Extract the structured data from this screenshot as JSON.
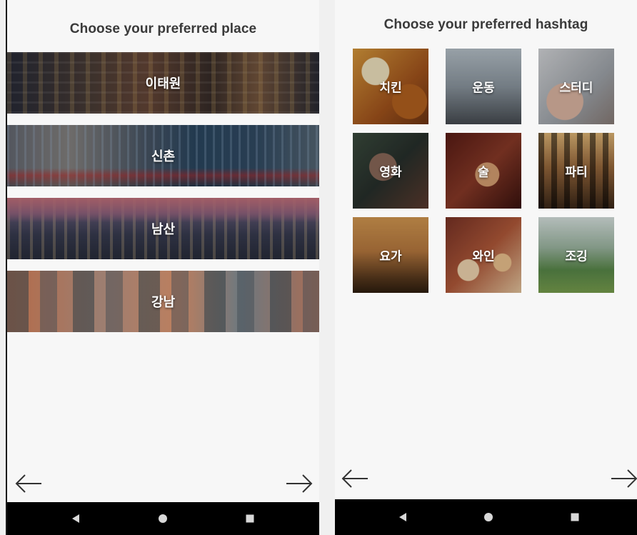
{
  "place_screen": {
    "title": "Choose your preferred place",
    "places": [
      {
        "label": "이태원",
        "icon": "itaewon-photo"
      },
      {
        "label": "신촌",
        "icon": "sinchon-photo"
      },
      {
        "label": "남산",
        "icon": "namsan-photo"
      },
      {
        "label": "강남",
        "icon": "gangnam-photo"
      }
    ]
  },
  "hashtag_screen": {
    "title": "Choose your preferred hashtag",
    "tags": [
      {
        "label": "치킨",
        "icon": "chicken-photo"
      },
      {
        "label": "운동",
        "icon": "exercise-photo"
      },
      {
        "label": "스터디",
        "icon": "study-photo"
      },
      {
        "label": "영화",
        "icon": "movie-photo"
      },
      {
        "label": "술",
        "icon": "drink-photo"
      },
      {
        "label": "파티",
        "icon": "party-photo"
      },
      {
        "label": "요가",
        "icon": "yoga-photo"
      },
      {
        "label": "와인",
        "icon": "wine-photo"
      },
      {
        "label": "조깅",
        "icon": "jogging-photo"
      }
    ]
  },
  "navigation": {
    "back_icon": "arrow-left-icon",
    "next_icon": "arrow-right-icon"
  },
  "system_bar": {
    "back_icon": "triangle-back-icon",
    "home_icon": "circle-home-icon",
    "recents_icon": "square-recents-icon"
  },
  "colors": {
    "screen_background": "#f7f7f7",
    "title_text": "#3a3a3a",
    "nav_bar": "#000000",
    "arrow": "#333333"
  }
}
